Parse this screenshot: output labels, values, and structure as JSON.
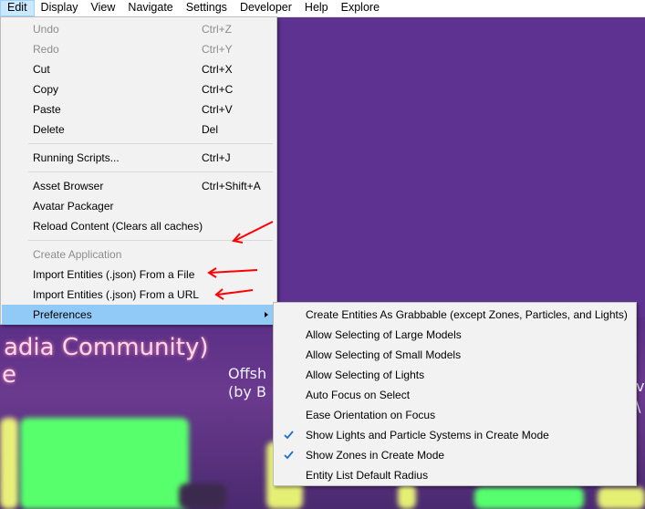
{
  "menubar": {
    "items": [
      {
        "label": "Edit"
      },
      {
        "label": "Display"
      },
      {
        "label": "View"
      },
      {
        "label": "Navigate"
      },
      {
        "label": "Settings"
      },
      {
        "label": "Developer"
      },
      {
        "label": "Help"
      },
      {
        "label": "Explore"
      }
    ]
  },
  "edit_menu": {
    "items": [
      {
        "label": "Undo",
        "shortcut": "Ctrl+Z",
        "disabled": true
      },
      {
        "label": "Redo",
        "shortcut": "Ctrl+Y",
        "disabled": true
      },
      {
        "label": "Cut",
        "shortcut": "Ctrl+X"
      },
      {
        "label": "Copy",
        "shortcut": "Ctrl+C"
      },
      {
        "label": "Paste",
        "shortcut": "Ctrl+V"
      },
      {
        "label": "Delete",
        "shortcut": "Del"
      },
      {
        "label": "Running Scripts...",
        "shortcut": "Ctrl+J"
      },
      {
        "label": "Asset Browser",
        "shortcut": "Ctrl+Shift+A"
      },
      {
        "label": "Avatar Packager",
        "shortcut": ""
      },
      {
        "label": "Reload Content (Clears all caches)",
        "shortcut": ""
      },
      {
        "label": "Create Application",
        "shortcut": "",
        "disabled": true
      },
      {
        "label": "Import Entities (.json) From a File",
        "shortcut": ""
      },
      {
        "label": "Import Entities (.json) From a URL",
        "shortcut": ""
      },
      {
        "label": "Preferences",
        "shortcut": "",
        "submenu": true
      }
    ]
  },
  "preferences_submenu": {
    "items": [
      {
        "label": "Create Entities As Grabbable (except Zones, Particles, and Lights)",
        "checked": false
      },
      {
        "label": "Allow Selecting of Large Models",
        "checked": false
      },
      {
        "label": "Allow Selecting of Small Models",
        "checked": false
      },
      {
        "label": "Allow Selecting of Lights",
        "checked": false
      },
      {
        "label": "Auto Focus on Select",
        "checked": false
      },
      {
        "label": "Ease Orientation on Focus",
        "checked": false
      },
      {
        "label": "Show Lights and Particle Systems in Create Mode",
        "checked": true
      },
      {
        "label": "Show Zones in Create Mode",
        "checked": true
      },
      {
        "label": "Entity List Default Radius",
        "checked": false
      }
    ]
  },
  "scene": {
    "text_line_1": "adia Community)",
    "text_line_2": "e",
    "text_offsh": "Offsh",
    "text_by": "(by B",
    "text_right_1": "v",
    "text_right_2": "\\"
  },
  "colors": {
    "menu_bg": "#f2f2f2",
    "highlight": "#91c9f7",
    "disabled_text": "#8d8d8d",
    "scene_purple": "#5e3290",
    "annotation_red": "#ff0000"
  }
}
